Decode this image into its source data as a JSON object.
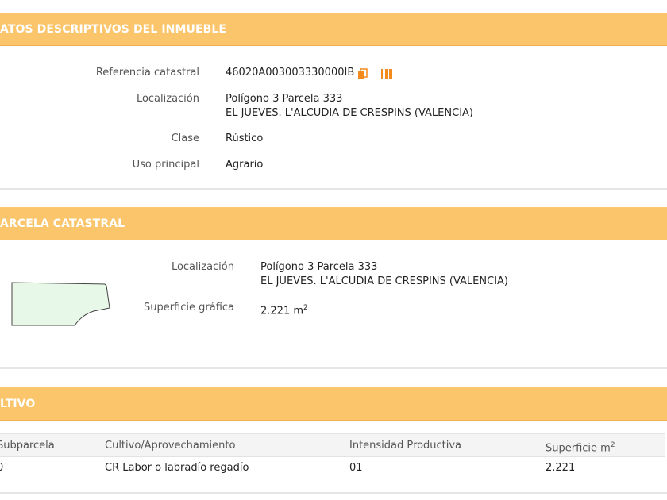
{
  "sections": {
    "datos": {
      "title": "ATOS DESCRIPTIVOS DEL INMUEBLE",
      "fields": {
        "referencia_label": "Referencia catastral",
        "referencia_value": "46020A003003330000IB",
        "localizacion_label": "Localización",
        "localizacion_line1": "Polígono 3 Parcela 333",
        "localizacion_line2": "EL JUEVES. L'ALCUDIA DE CRESPINS (VALENCIA)",
        "clase_label": "Clase",
        "clase_value": "Rústico",
        "uso_label": "Uso principal",
        "uso_value": "Agrario"
      }
    },
    "parcela": {
      "title": "ARCELA CATASTRAL",
      "localizacion_label": "Localización",
      "localizacion_line1": "Polígono 3 Parcela 333",
      "localizacion_line2": "EL JUEVES. L'ALCUDIA DE CRESPINS (VALENCIA)",
      "superficie_label": "Superficie gráfica",
      "superficie_value": "2.221 m",
      "superficie_exp": "2"
    },
    "cultivo": {
      "title": "LTIVO",
      "headers": {
        "subparcela": "Subparcela",
        "cultivo": "Cultivo/Aprovechamiento",
        "intensidad": "Intensidad Productiva",
        "superficie": "Superficie m",
        "superficie_exp": "2"
      },
      "rows": [
        {
          "subparcela": "0",
          "cultivo": "CR Labor o labradío regadío",
          "intensidad": "01",
          "superficie": "2.221"
        }
      ]
    }
  },
  "colors": {
    "band": "#fbc56b",
    "icon_accent": "#f28a1c",
    "parcel_fill": "#e8f8e8"
  },
  "icons": [
    "copy-icon",
    "barcode-icon"
  ]
}
